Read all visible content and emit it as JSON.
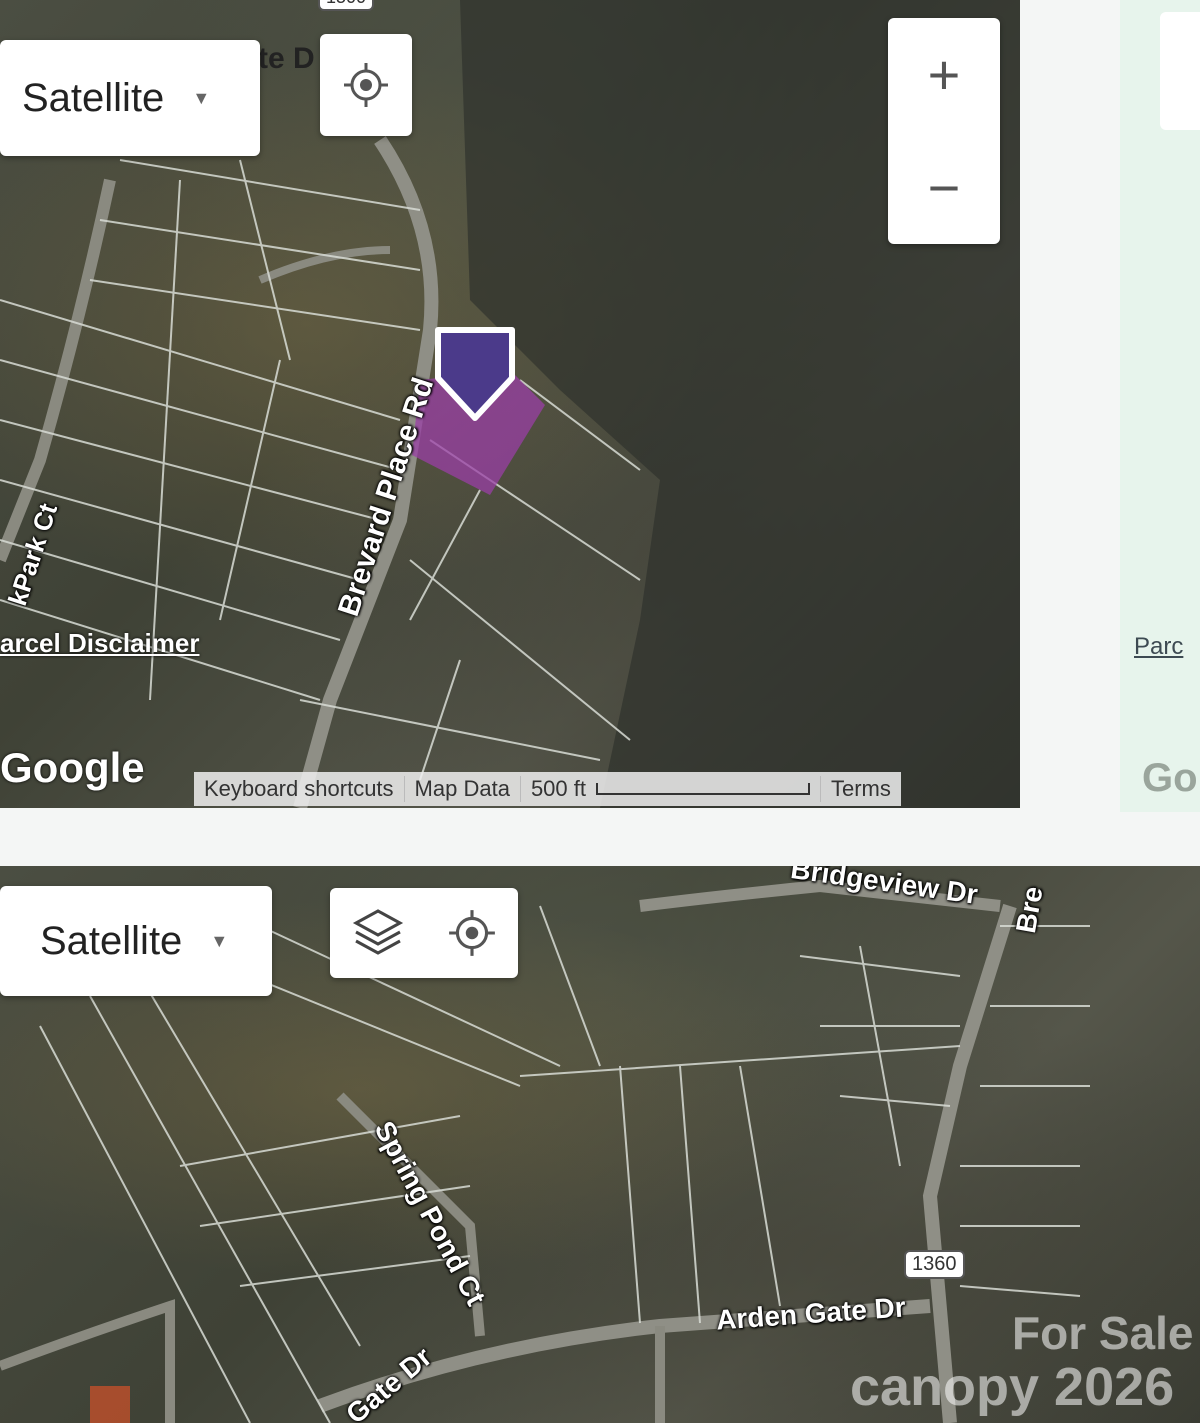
{
  "top_map": {
    "map_type_label": "Satellite",
    "road_labels": [
      "Brevard Place Rd",
      "kPark Ct",
      "te D"
    ],
    "route_number_cut": "1500",
    "parcel_disclaimer": "arcel Disclaimer",
    "google_logo": "Google",
    "footer": {
      "keyboard_shortcuts": "Keyboard shortcuts",
      "map_data": "Map Data",
      "scale": "500 ft",
      "terms": "Terms"
    },
    "zoom_in": "+",
    "zoom_out": "−",
    "marker_color": "#4b3a8a",
    "parcel_highlight_color": "#9a3fa5"
  },
  "side_panel": {
    "parcel_text": "Parc",
    "google_text": "Go"
  },
  "bottom_map": {
    "map_type_label": "Satellite",
    "road_labels": [
      "Bridgeview Dr",
      "Bre",
      "Spring Pond Ct",
      "Arden Gate Dr",
      "Gate Dr"
    ],
    "route_shield": "1360"
  },
  "watermark": {
    "line1": "For Sale",
    "line2": "canopy 2026"
  },
  "icons": [
    "caret-down-icon",
    "locate-icon",
    "layers-icon",
    "zoom-in-icon",
    "zoom-out-icon",
    "location-marker-icon"
  ]
}
